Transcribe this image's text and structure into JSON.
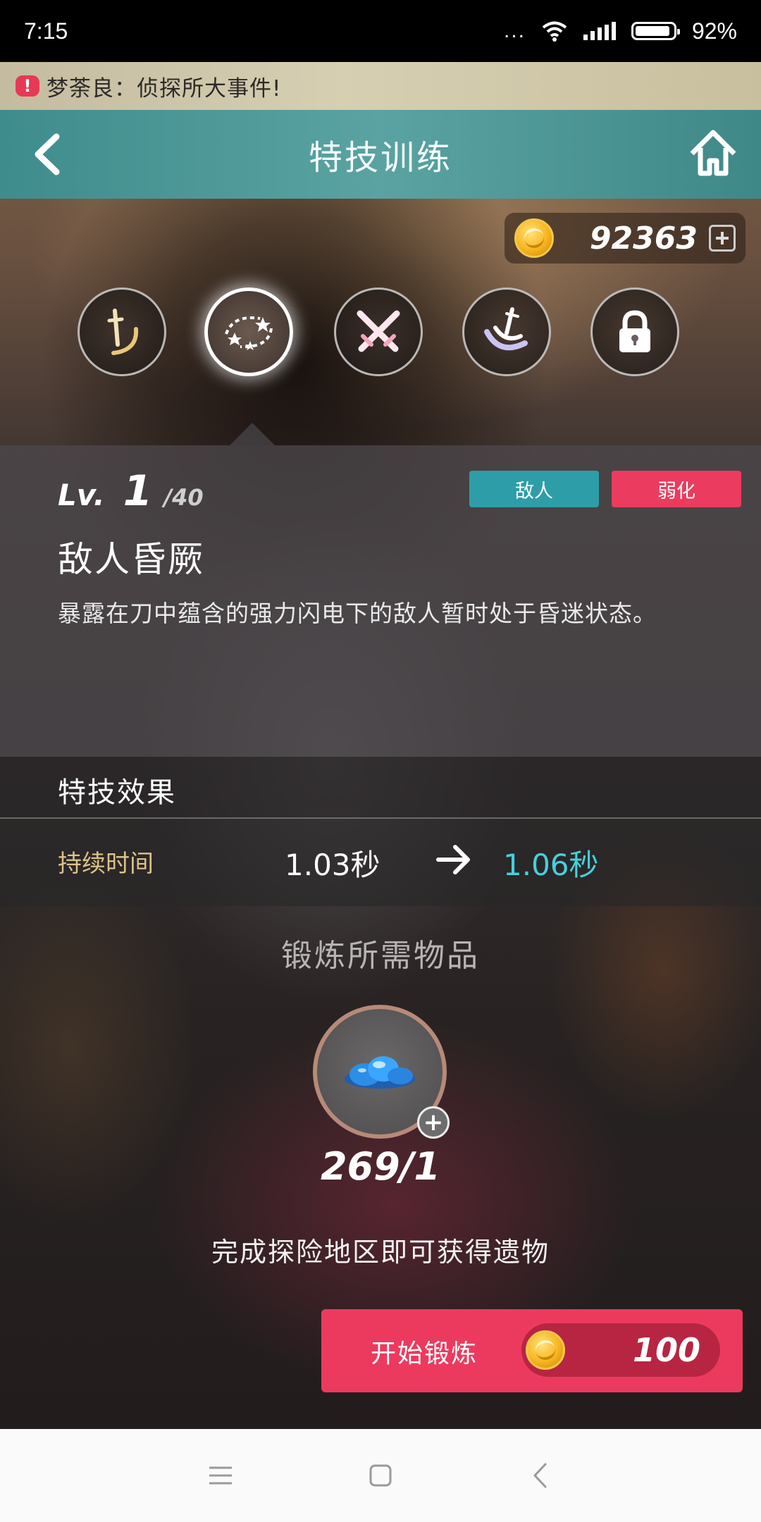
{
  "status_bar": {
    "time": "7:15",
    "more": "...",
    "battery": "92%",
    "battery_level": 0.92,
    "icons": [
      "wifi-icon",
      "signal-icon",
      "battery-icon"
    ]
  },
  "news": {
    "text": "梦荼良：侦探所大事件!",
    "alert_symbol": "!"
  },
  "header": {
    "title": "特技训练",
    "back_icon": "chevron-left-icon",
    "home_icon": "home-icon"
  },
  "currency": {
    "amount": "92363",
    "add_icon": "plus-icon"
  },
  "skills": [
    {
      "icon": "sword-slash-icon",
      "state": "unlocked"
    },
    {
      "icon": "stars-swirl-icon",
      "state": "selected"
    },
    {
      "icon": "crossed-swords-icon",
      "state": "unlocked"
    },
    {
      "icon": "blade-wave-icon",
      "state": "unlocked"
    },
    {
      "icon": "lock-icon",
      "state": "locked"
    }
  ],
  "skill_info": {
    "level_label": "Lv.",
    "level": "1",
    "max_level": "/40",
    "tags": [
      "敌人",
      "弱化"
    ],
    "tag_colors": [
      "#2d9ea7",
      "#eb3b5f"
    ],
    "name": "敌人昏厥",
    "description": "暴露在刀中蕴含的强力闪电下的敌人暂时处于昏迷状态。"
  },
  "effect": {
    "title": "特技效果",
    "rows": [
      {
        "name": "持续时间",
        "from": "1.03秒",
        "to": "1.06秒"
      }
    ]
  },
  "materials": {
    "title": "锻炼所需物品",
    "count": "269/1",
    "hint": "完成探险地区即可获得遗物",
    "item_icon": "blue-crystal-icon"
  },
  "forge": {
    "label": "开始锻炼",
    "cost": "100"
  },
  "colors": {
    "accent_teal": "#2d9ea7",
    "accent_red": "#ec3a5e",
    "upgrade_value": "#46d0dc",
    "effect_label": "#dcc389"
  }
}
